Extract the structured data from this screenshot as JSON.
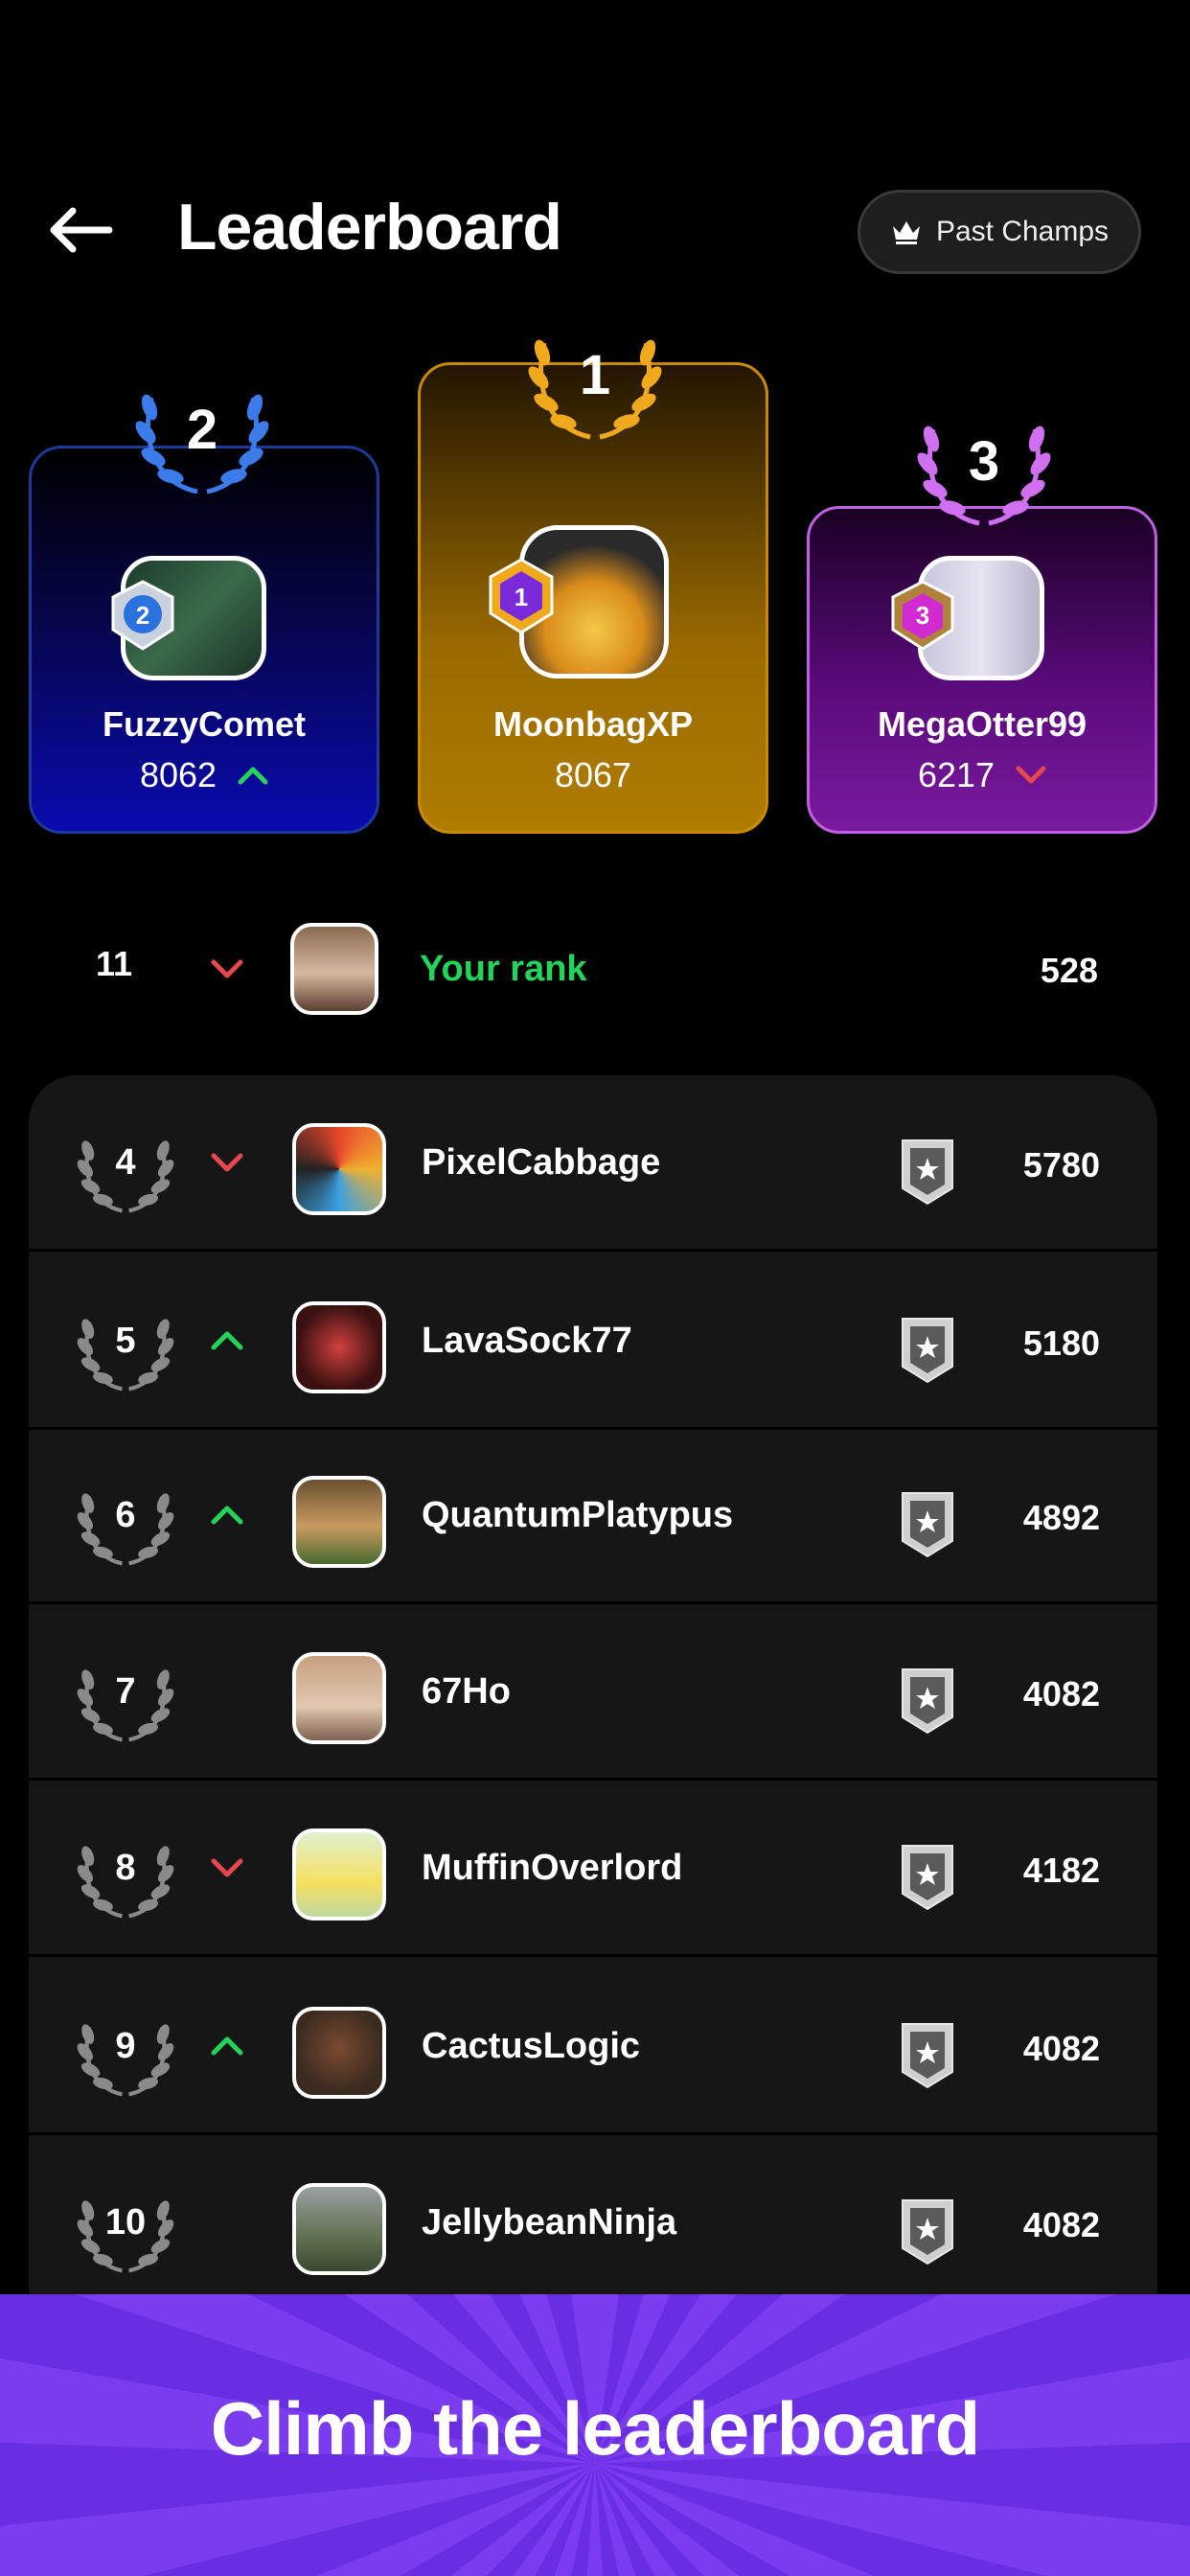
{
  "header": {
    "title": "Leaderboard",
    "past_champs_label": "Past Champs"
  },
  "podium": [
    {
      "place": "2",
      "badge": "2",
      "name": "FuzzyComet",
      "score": "8062",
      "trend": "up"
    },
    {
      "place": "1",
      "badge": "1",
      "name": "MoonbagXP",
      "score": "8067",
      "trend": "none"
    },
    {
      "place": "3",
      "badge": "3",
      "name": "MegaOtter99",
      "score": "6217",
      "trend": "down"
    }
  ],
  "your_rank": {
    "rank": "11",
    "label": "Your rank",
    "score": "528",
    "trend": "down"
  },
  "rows": [
    {
      "rank": "4",
      "name": "PixelCabbage",
      "score": "5780",
      "trend": "down"
    },
    {
      "rank": "5",
      "name": "LavaSock77",
      "score": "5180",
      "trend": "up"
    },
    {
      "rank": "6",
      "name": "QuantumPlatypus",
      "score": "4892",
      "trend": "up"
    },
    {
      "rank": "7",
      "name": "67Ho",
      "score": "4082",
      "trend": "none"
    },
    {
      "rank": "8",
      "name": "MuffinOverlord",
      "score": "4182",
      "trend": "down"
    },
    {
      "rank": "9",
      "name": "CactusLogic",
      "score": "4082",
      "trend": "up"
    },
    {
      "rank": "10",
      "name": "JellybeanNinja",
      "score": "4082",
      "trend": "none"
    }
  ],
  "banner": {
    "text": "Climb the leaderboard"
  },
  "colors": {
    "up": "#22d45a",
    "down": "#e5484d",
    "your_rank": "#22d45a",
    "gold": "#f0a81c",
    "silver_blue": "#3b7bea",
    "bronze_purple": "#d070f0"
  },
  "icons": {
    "back": "arrow-left-icon",
    "past_champs": "crown-icon",
    "rank_frame": "laurel-icon",
    "tier": "shield-star-icon"
  }
}
